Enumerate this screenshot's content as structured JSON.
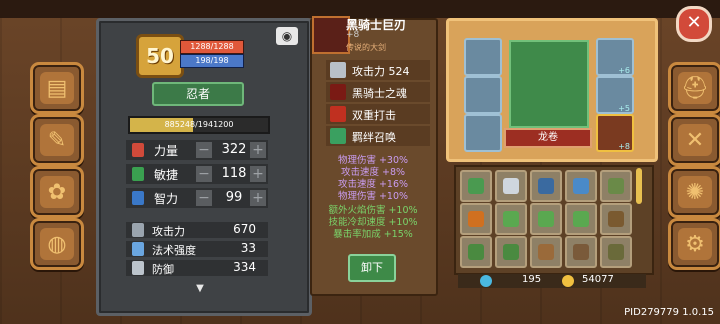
{
  "player": {
    "level": "50",
    "hp": "1288/1288",
    "mp": "198/198",
    "class": "忍者",
    "xp": "885248/1941200",
    "xp_ratio": 0.456
  },
  "attributes": [
    {
      "label": "力量",
      "value": "322",
      "icon": "fist-icon",
      "color": "#d04a3a"
    },
    {
      "label": "敏捷",
      "value": "118",
      "icon": "feather-icon",
      "color": "#3aa050"
    },
    {
      "label": "智力",
      "value": "99",
      "icon": "book-icon",
      "color": "#3a78c8"
    }
  ],
  "combat": [
    {
      "label": "攻击力",
      "value": "670",
      "icon": "sword-icon"
    },
    {
      "label": "法术强度",
      "value": "33",
      "icon": "wand-icon"
    },
    {
      "label": "防御",
      "value": "334",
      "icon": "shield-icon"
    }
  ],
  "item": {
    "name": "黑骑士巨刃",
    "plus": "+8",
    "tier": "传说的大剑",
    "attack": "攻击力 524",
    "skills": [
      "黑骑士之魂",
      "双重打击",
      "羁绊召唤"
    ],
    "bonuses": [
      "物理伤害 +30%",
      "攻击速度 +8%",
      "攻击速度 +16%",
      "物理伤害 +10%",
      "额外火焰伤害 +10%",
      "技能冷却速度 +10%",
      "暴击率加成 +15%"
    ],
    "unequip_label": "卸下"
  },
  "equipment": {
    "pet_name": "龙卷",
    "slot_plus": [
      "+6",
      "+5",
      "+8"
    ]
  },
  "currency": {
    "gems": "195",
    "gold": "54077"
  },
  "footer": {
    "pid": "PID279779 1.0.15"
  },
  "close_icon": "close-icon"
}
